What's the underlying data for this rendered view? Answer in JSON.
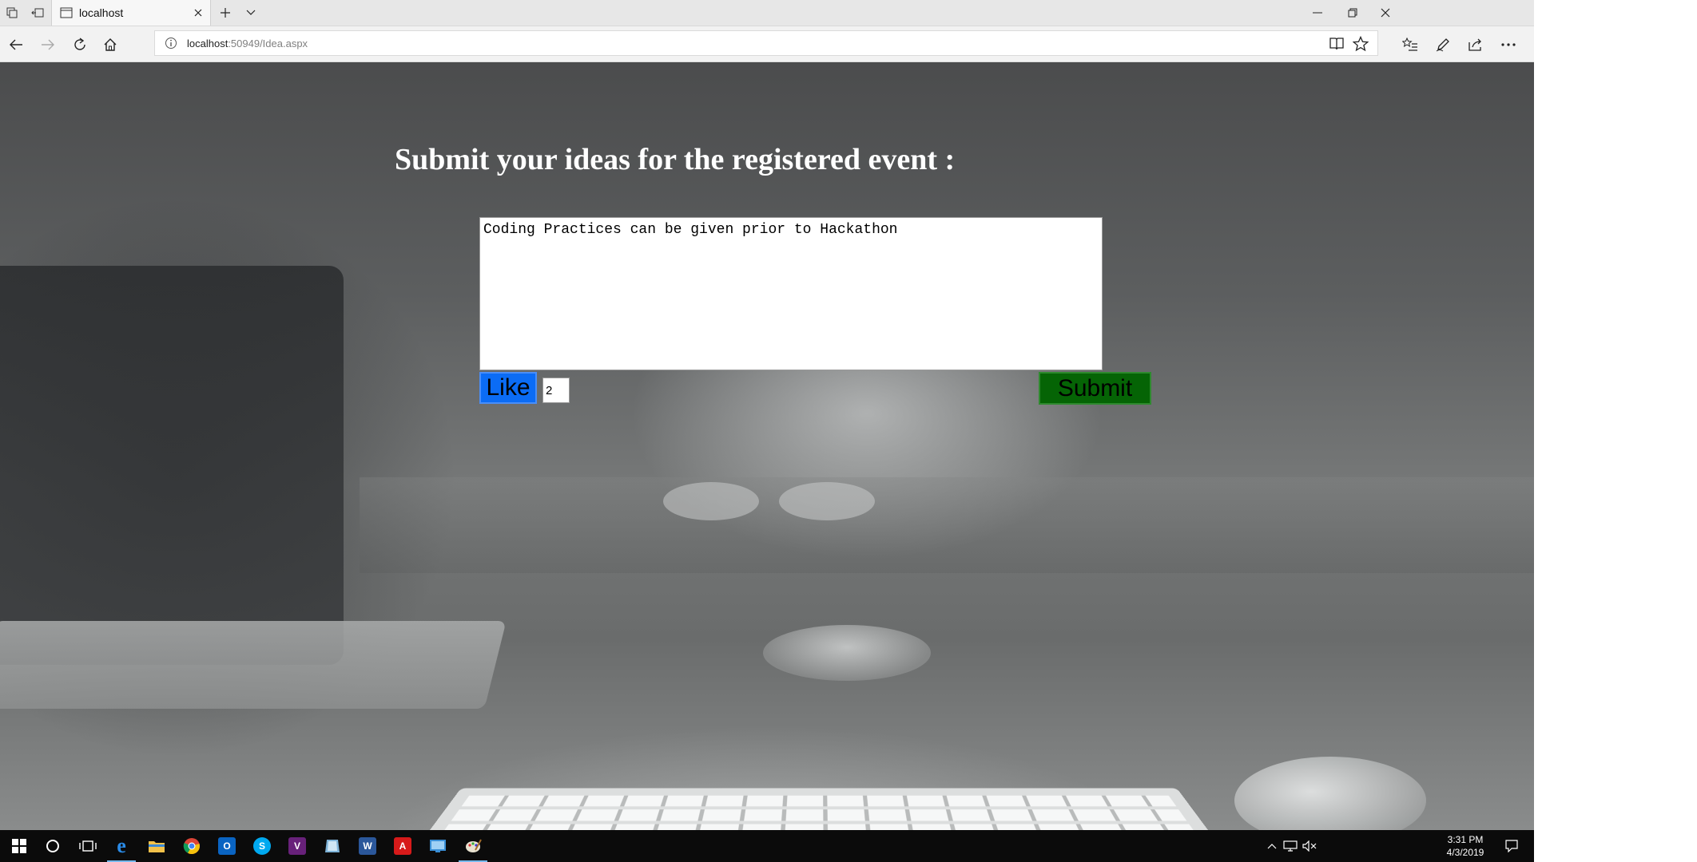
{
  "browser": {
    "tab_title": "localhost",
    "url_host": "localhost",
    "url_path": ":50949/Idea.aspx"
  },
  "page": {
    "heading": "Submit your ideas for the registered event :",
    "idea_text": "Coding Practices can be given prior to Hackathon",
    "like_label": "Like",
    "like_count": "2",
    "submit_label": "Submit"
  },
  "taskbar": {
    "time": "3:31 PM",
    "date": "4/3/2019",
    "apps": [
      "start-icon",
      "cortana-icon",
      "task-view-icon",
      "edge-icon",
      "file-explorer-icon",
      "chrome-icon",
      "outlook-icon",
      "skype-icon",
      "visual-studio-icon",
      "app-icon",
      "word-icon",
      "acrobat-icon",
      "app-icon",
      "paint-icon"
    ]
  },
  "colors": {
    "like_button": "#0b6cf5",
    "submit_button": "#056405",
    "heading": "#ffffff",
    "taskbar": "#0b0b0b"
  }
}
